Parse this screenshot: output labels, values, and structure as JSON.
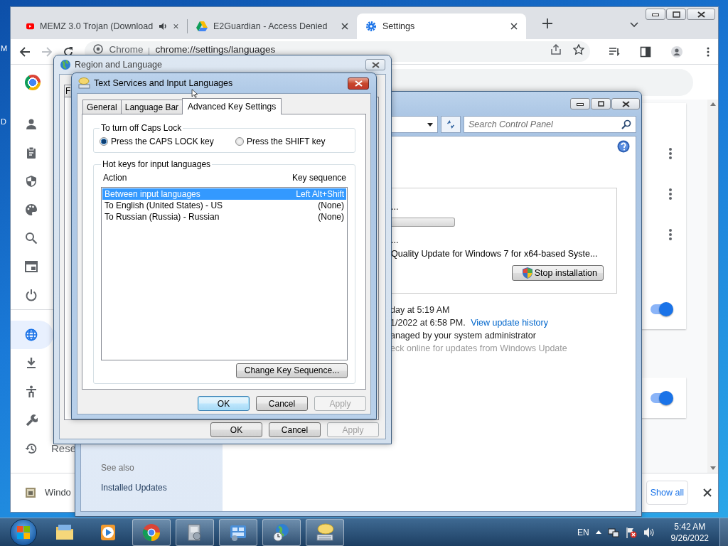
{
  "desktop": {
    "labels": [
      "M",
      "D"
    ]
  },
  "browser": {
    "tabs": [
      {
        "title": "MEMZ 3.0 Trojan (Download",
        "audio": true,
        "selected": false
      },
      {
        "title": "E2Guardian - Access Denied",
        "audio": false,
        "selected": false
      },
      {
        "title": "Settings",
        "audio": false,
        "selected": true
      }
    ],
    "omnibox": {
      "site": "Chrome",
      "url": "chrome://settings/languages"
    },
    "sidebar": [
      {
        "selected": false
      },
      {
        "selected": false
      },
      {
        "selected": false
      },
      {
        "selected": false
      },
      {
        "selected": false
      },
      {
        "selected": false
      },
      {
        "selected": false
      },
      {
        "selected": true
      },
      {
        "selected": false
      },
      {
        "selected": false
      },
      {
        "selected": false
      },
      {
        "selected": false,
        "label": "Rese"
      }
    ],
    "settings_rows": [
      {
        "kind": "menu"
      },
      {
        "kind": "menu"
      },
      {
        "kind": "menu"
      },
      {
        "kind": "toggle",
        "on": true
      },
      {
        "kind": "toggle",
        "on": true
      }
    ],
    "download_bar": {
      "item": "Windo",
      "button": "Show all"
    }
  },
  "control_panel": {
    "search": {
      "placeholder": "Search Control Panel"
    },
    "status_lines": [
      "...",
      "...",
      "Quality Update for Windows 7 for x64-based Syste..."
    ],
    "progress": {
      "level": 0
    },
    "stop_button": "Stop installation",
    "info": [
      {
        "text": "day at 5:19 AM",
        "muted": false
      },
      {
        "text": "1/2022 at 6:58 PM.",
        "link": "View update history",
        "muted": false
      },
      {
        "text": "anaged by your system administrator",
        "muted": false
      },
      {
        "text": "eck online for updates from Windows Update",
        "muted": true
      }
    ],
    "see_also": "See also",
    "links": [
      "Installed Updates"
    ]
  },
  "region_dialog": {
    "title": "Region and Language",
    "tab": "F",
    "buttons": [
      {
        "label": "OK",
        "disabled": false
      },
      {
        "label": "Cancel",
        "disabled": false
      },
      {
        "label": "Apply",
        "disabled": true
      }
    ]
  },
  "text_services_dialog": {
    "title": "Text Services and Input Languages",
    "tabs": [
      {
        "label": "General",
        "selected": false
      },
      {
        "label": "Language Bar",
        "selected": false
      },
      {
        "label": "Advanced Key Settings",
        "selected": true
      }
    ],
    "caps_group": {
      "title": "To turn off Caps Lock",
      "options": [
        {
          "label": "Press the CAPS LOCK key",
          "selected": true
        },
        {
          "label": "Press the SHIFT key",
          "selected": false
        }
      ]
    },
    "hotkeys": {
      "title": "Hot keys for input languages",
      "columns": [
        "Action",
        "Key sequence"
      ],
      "rows": [
        {
          "action": "Between input languages",
          "keys": "Left Alt+Shift",
          "selected": true
        },
        {
          "action": "To English (United States) - US",
          "keys": "(None)",
          "selected": false
        },
        {
          "action": "To Russian (Russia) - Russian",
          "keys": "(None)",
          "selected": false
        }
      ]
    },
    "change_button": "Change Key Sequence...",
    "buttons": [
      {
        "label": "OK",
        "default": true,
        "disabled": false
      },
      {
        "label": "Cancel",
        "default": false,
        "disabled": false
      },
      {
        "label": "Apply",
        "default": false,
        "disabled": true
      }
    ]
  },
  "taskbar": {
    "apps": [
      {
        "open": false
      },
      {
        "open": false
      },
      {
        "open": true
      },
      {
        "open": true
      },
      {
        "open": true
      },
      {
        "open": true
      },
      {
        "open": true
      }
    ],
    "language": "EN",
    "time": "5:42 AM",
    "date": "9/26/2022"
  }
}
